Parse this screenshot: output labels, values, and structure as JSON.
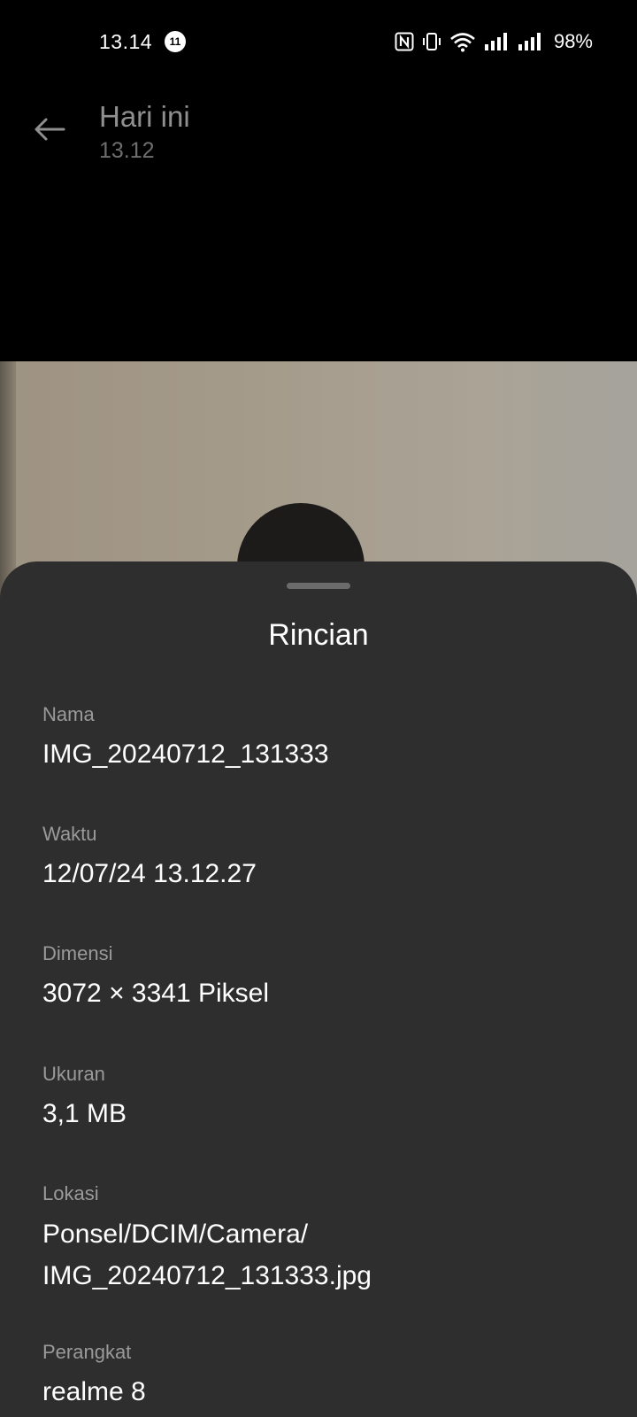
{
  "status_bar": {
    "time": "13.14",
    "notification_count": "11",
    "battery": "98%"
  },
  "header": {
    "title": "Hari ini",
    "subtitle": "13.12"
  },
  "details": {
    "title": "Rincian",
    "items": [
      {
        "label": "Nama",
        "value": "IMG_20240712_131333"
      },
      {
        "label": "Waktu",
        "value": "12/07/24 13.12.27"
      },
      {
        "label": "Dimensi",
        "value": "3072 × 3341 Piksel"
      },
      {
        "label": "Ukuran",
        "value": "3,1 MB"
      },
      {
        "label": "Lokasi",
        "value_lines": [
          "Ponsel/DCIM/Camera/",
          "IMG_20240712_131333.jpg"
        ]
      },
      {
        "label": "Perangkat",
        "value": "realme 8"
      }
    ]
  }
}
